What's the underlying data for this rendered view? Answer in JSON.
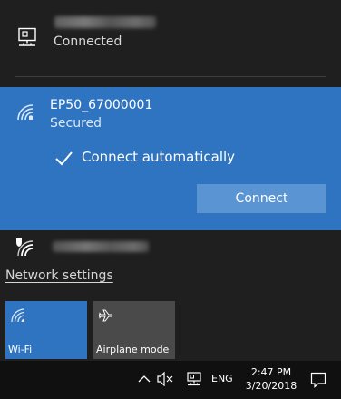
{
  "wired": {
    "status": "Connected",
    "icon": "ethernet-icon"
  },
  "wifi_selected": {
    "name": "EP50_67000001",
    "status": "Secured",
    "auto_label": "Connect automatically",
    "auto_checked": true,
    "connect_label": "Connect",
    "icon": "wifi-secured-icon"
  },
  "wifi_other": {
    "icon": "wifi-shield-icon"
  },
  "network_settings": "Network settings",
  "quick_actions": [
    {
      "label": "Wi-Fi",
      "icon": "wifi-icon",
      "active": true
    },
    {
      "label": "Airplane mode",
      "icon": "airplane-icon",
      "active": false
    }
  ],
  "taskbar": {
    "lang": "ENG",
    "time": "2:47 PM",
    "date": "3/20/2018"
  },
  "colors": {
    "accent": "#2f74c0",
    "flyout_bg": "#1f1f1f",
    "taskbar_bg": "#101010"
  }
}
